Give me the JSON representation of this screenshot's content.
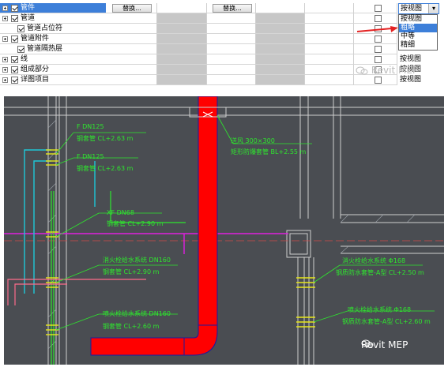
{
  "grid": {
    "rows": [
      {
        "label": "管件",
        "selected": true,
        "expander": true,
        "indent": false,
        "swap1": "替换...",
        "swap2": "替换..."
      },
      {
        "label": "管道",
        "selected": false,
        "expander": true,
        "indent": false
      },
      {
        "label": "管道占位符",
        "selected": false,
        "expander": false,
        "indent": true
      },
      {
        "label": "管道附件",
        "selected": false,
        "expander": true,
        "indent": false
      },
      {
        "label": "管道隔热层",
        "selected": false,
        "expander": false,
        "indent": true
      },
      {
        "label": "线",
        "selected": false,
        "expander": true,
        "indent": false
      },
      {
        "label": "组成部分",
        "selected": false,
        "expander": true,
        "indent": false
      },
      {
        "label": "详图项目",
        "selected": false,
        "expander": true,
        "indent": false
      }
    ],
    "detail_select": {
      "value": "按视图",
      "options": [
        "按视图",
        "粗略",
        "中等",
        "精细"
      ],
      "highlighted": "粗略"
    },
    "detail_values_below": [
      "按视图",
      "按视图",
      "按视图"
    ]
  },
  "watermark": {
    "text": "Revit MEP"
  },
  "cad": {
    "annotations": [
      "F DN125",
      "钢套管 CL+2.63 m",
      "F DN125",
      "钢套管 CL+2.63 m",
      "XF DN68",
      "钢套管 CL+2.90 m",
      "消火栓给水系统 DN160",
      "钢套管 CL+2.90 m",
      "喷火栓给水系统 DN160",
      "钢套管 CL+2.60 m",
      "送风 300×300",
      "矩形防爆套管 BL+2.55 m",
      "消火栓给水系统 Φ168",
      "钢质防水套管-A型 CL+2.50 m",
      "喷火栓给水系统 Φ168",
      "钢质防水套管-A型 CL+2.60 m"
    ],
    "colors": {
      "duct": "#ff0000",
      "green": "#2ee62e",
      "cyan": "#1ec8d8",
      "magenta": "#e020e0",
      "pink": "#ff6b8a",
      "yellow": "#e8e81a",
      "wall": "#d0d0d0",
      "bg": "#4a4d52"
    }
  }
}
